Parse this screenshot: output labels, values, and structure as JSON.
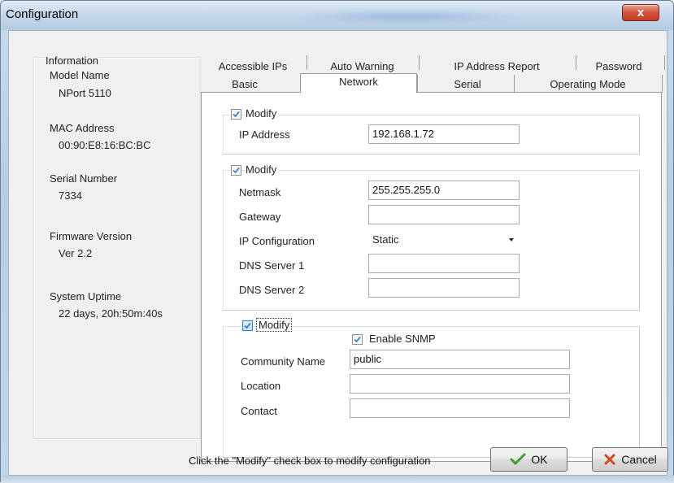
{
  "window": {
    "title": "Configuration",
    "close_label": "x"
  },
  "info": {
    "heading": "Information",
    "model_name_label": "Model Name",
    "model_name_value": "NPort 5110",
    "mac_label": "MAC Address",
    "mac_value": "00:90:E8:16:BC:BC",
    "serial_label": "Serial Number",
    "serial_value": "7334",
    "firmware_label": "Firmware Version",
    "firmware_value": "Ver 2.2",
    "uptime_label": "System Uptime",
    "uptime_value": "22 days, 20h:50m:40s"
  },
  "tabs": {
    "row1": [
      "Accessible IPs",
      "Auto Warning",
      "IP Address Report",
      "Password"
    ],
    "row2": [
      "Basic",
      "Network",
      "Serial",
      "Operating Mode"
    ],
    "active": "Network"
  },
  "network": {
    "group1": {
      "modify_label": "Modify",
      "modify_checked": true,
      "ip_label": "IP Address",
      "ip_value": "192.168.1.72"
    },
    "group2": {
      "modify_label": "Modify",
      "modify_checked": true,
      "netmask_label": "Netmask",
      "netmask_value": "255.255.255.0",
      "gateway_label": "Gateway",
      "gateway_value": "",
      "ipconfig_label": "IP Configuration",
      "ipconfig_value": "Static",
      "dns1_label": "DNS Server 1",
      "dns1_value": "",
      "dns2_label": "DNS Server 2",
      "dns2_value": ""
    },
    "group3": {
      "modify_label": "Modify",
      "modify_checked": true,
      "snmp_label": "Enable SNMP",
      "snmp_checked": true,
      "community_label": "Community Name",
      "community_value": "public",
      "location_label": "Location",
      "location_value": "",
      "contact_label": "Contact",
      "contact_value": ""
    }
  },
  "footer": {
    "hint": "Click the \"Modify\" check box to modify configuration",
    "ok_label": "OK",
    "cancel_label": "Cancel"
  },
  "colors": {
    "check_accent": "#3b7fd0",
    "ok_icon": "#3f9e2e",
    "cancel_icon": "#d04a1f"
  }
}
